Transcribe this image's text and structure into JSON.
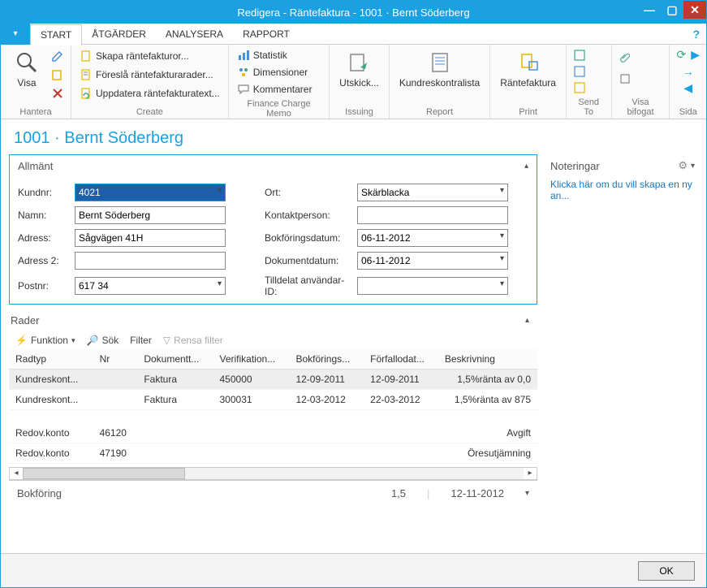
{
  "title": "Redigera - Räntefaktura - 1001 · Bernt Söderberg",
  "menu": {
    "start": "START",
    "atgarder": "ÅTGÄRDER",
    "analysera": "ANALYSERA",
    "rapport": "RAPPORT"
  },
  "ribbon": {
    "hantera_label": "Hantera",
    "visa": "Visa",
    "create_label": "Create",
    "skapa": "Skapa räntefakturor...",
    "foresla": "Föreslå räntefakturarader...",
    "uppdatera": "Uppdatera räntefakturatext...",
    "fcm_label": "Finance Charge Memo",
    "statistik": "Statistik",
    "dimensioner": "Dimensioner",
    "kommentarer": "Kommentarer",
    "issuing_label": "Issuing",
    "utskick": "Utskick...",
    "report_label": "Report",
    "kundreskontralista": "Kundreskontralista",
    "print_label": "Print",
    "rantefaktura": "Räntefaktura",
    "sendto_label": "Send To",
    "visabifogat_label": "Visa bifogat",
    "sida_label": "Sida"
  },
  "page_heading": "1001 · Bernt Söderberg",
  "allmant": {
    "header": "Allmänt",
    "kundnr_label": "Kundnr:",
    "kundnr": "4021",
    "namn_label": "Namn:",
    "namn": "Bernt Söderberg",
    "adress_label": "Adress:",
    "adress": "Sågvägen 41H",
    "adress2_label": "Adress 2:",
    "adress2": "",
    "postnr_label": "Postnr:",
    "postnr": "617 34",
    "ort_label": "Ort:",
    "ort": "Skärblacka",
    "kontakt_label": "Kontaktperson:",
    "kontakt": "",
    "bokdatum_label": "Bokföringsdatum:",
    "bokdatum": "06-11-2012",
    "dokdatum_label": "Dokumentdatum:",
    "dokdatum": "06-11-2012",
    "anvid_label": "Tilldelat användar-ID:",
    "anvid": ""
  },
  "rader": {
    "header": "Rader",
    "funktion": "Funktion",
    "sok": "Sök",
    "filter": "Filter",
    "rensa": "Rensa filter",
    "cols": {
      "radtyp": "Radtyp",
      "nr": "Nr",
      "dokument": "Dokumentt...",
      "verifik": "Verifikation...",
      "bokf": "Bokförings...",
      "forfall": "Förfallodat...",
      "beskr": "Beskrivning"
    },
    "rows": [
      {
        "radtyp": "Kundreskont...",
        "nr": "",
        "dokument": "Faktura",
        "verifik": "450000",
        "bokf": "12-09-2011",
        "forfall": "12-09-2011",
        "beskr": "1,5%ränta av 0,0"
      },
      {
        "radtyp": "Kundreskont...",
        "nr": "",
        "dokument": "Faktura",
        "verifik": "300031",
        "bokf": "12-03-2012",
        "forfall": "22-03-2012",
        "beskr": "1,5%ränta av 875"
      },
      {
        "radtyp": "Redov.konto",
        "nr": "46120",
        "dokument": "",
        "verifik": "",
        "bokf": "",
        "forfall": "",
        "beskr": "Avgift"
      },
      {
        "radtyp": "Redov.konto",
        "nr": "47190",
        "dokument": "",
        "verifik": "",
        "bokf": "",
        "forfall": "",
        "beskr": "Öresutjämning"
      }
    ]
  },
  "bokforing": {
    "label": "Bokföring",
    "v1": "1,5",
    "v2": "12-11-2012"
  },
  "noteringar": {
    "header": "Noteringar",
    "link": "Klicka här om du vill skapa en ny an..."
  },
  "footer": {
    "ok": "OK"
  }
}
